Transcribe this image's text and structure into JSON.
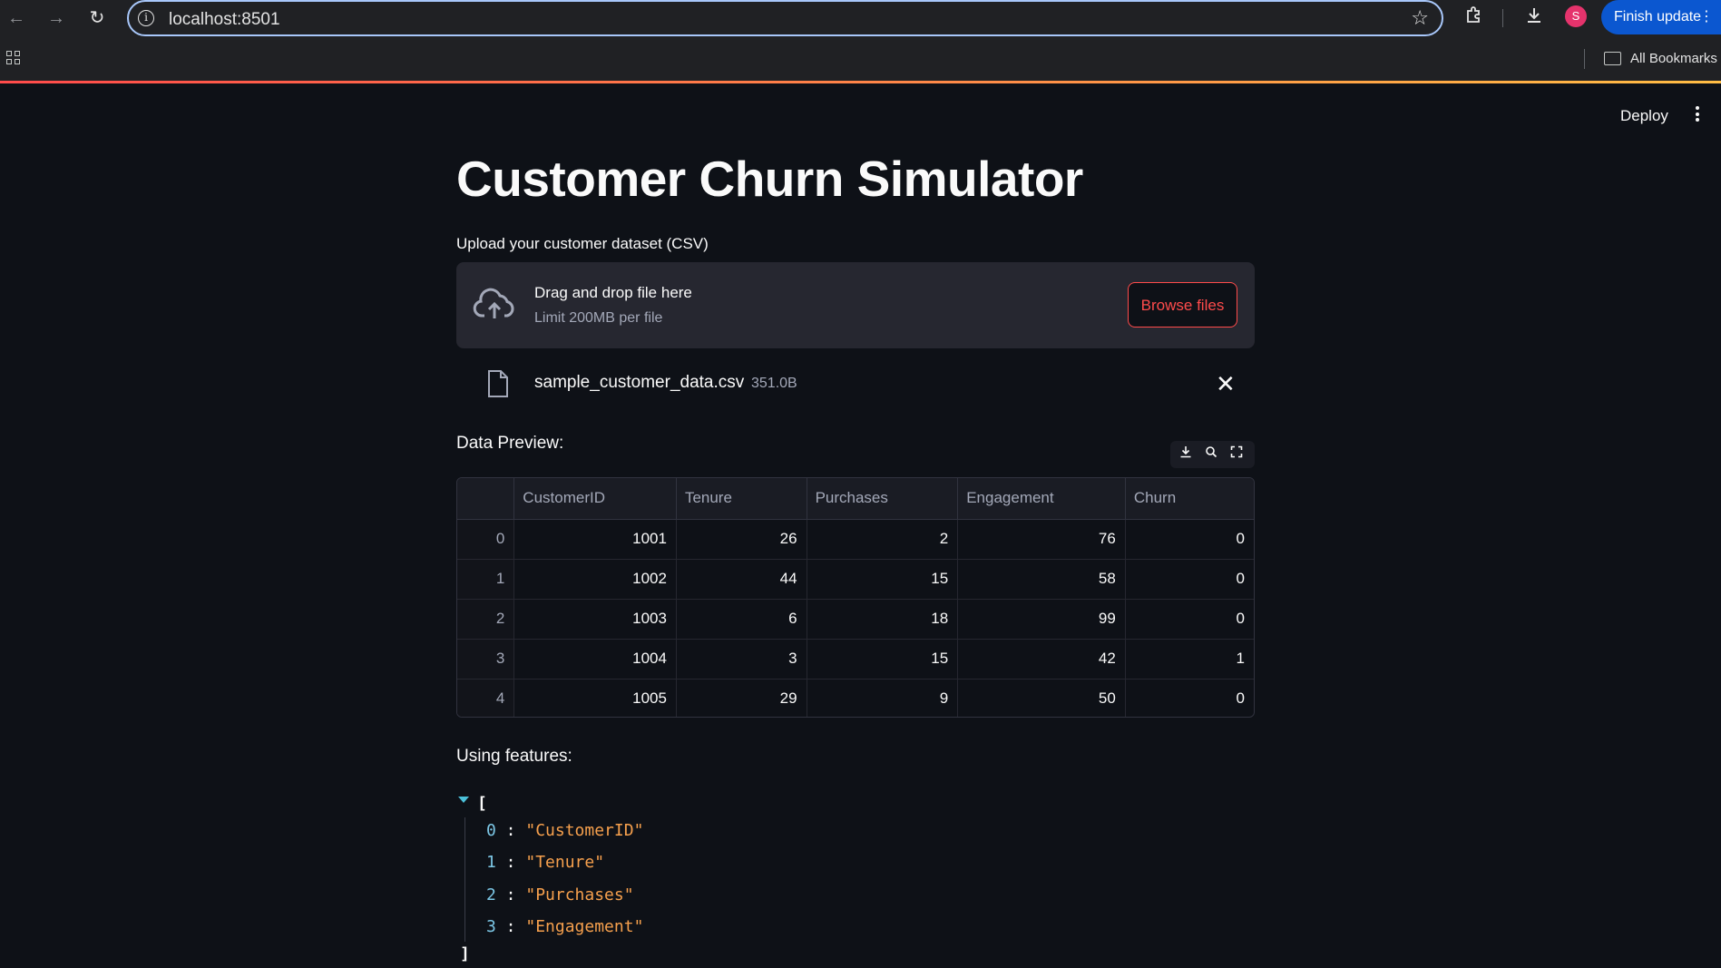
{
  "browser": {
    "url": "localhost:8501",
    "finish_update_label": "Finish update",
    "avatar_letter": "S",
    "all_bookmarks_label": "All Bookmarks"
  },
  "app": {
    "deploy_label": "Deploy",
    "title": "Customer Churn Simulator",
    "uploader": {
      "label": "Upload your customer dataset (CSV)",
      "drag_text": "Drag and drop file here",
      "limit_text": "Limit 200MB per file",
      "browse_label": "Browse files"
    },
    "file": {
      "name": "sample_customer_data.csv",
      "size": "351.0B"
    },
    "preview_label": "Data Preview:",
    "table": {
      "columns": [
        "",
        "CustomerID",
        "Tenure",
        "Purchases",
        "Engagement",
        "Churn"
      ],
      "rows": [
        [
          "0",
          "1001",
          "26",
          "2",
          "76",
          "0"
        ],
        [
          "1",
          "1002",
          "44",
          "15",
          "58",
          "0"
        ],
        [
          "2",
          "1003",
          "6",
          "18",
          "99",
          "0"
        ],
        [
          "3",
          "1004",
          "3",
          "15",
          "42",
          "1"
        ],
        [
          "4",
          "1005",
          "29",
          "9",
          "50",
          "0"
        ]
      ]
    },
    "features_label": "Using features:",
    "features_json": {
      "open": "[",
      "close": "]",
      "items": [
        {
          "index": "0",
          "value": "\"CustomerID\""
        },
        {
          "index": "1",
          "value": "\"Tenure\""
        },
        {
          "index": "2",
          "value": "\"Purchases\""
        },
        {
          "index": "3",
          "value": "\"Engagement\""
        }
      ]
    }
  },
  "colors": {
    "accent": "#ff4b4b",
    "background": "#0e1117",
    "json_value": "#f6a04d"
  }
}
